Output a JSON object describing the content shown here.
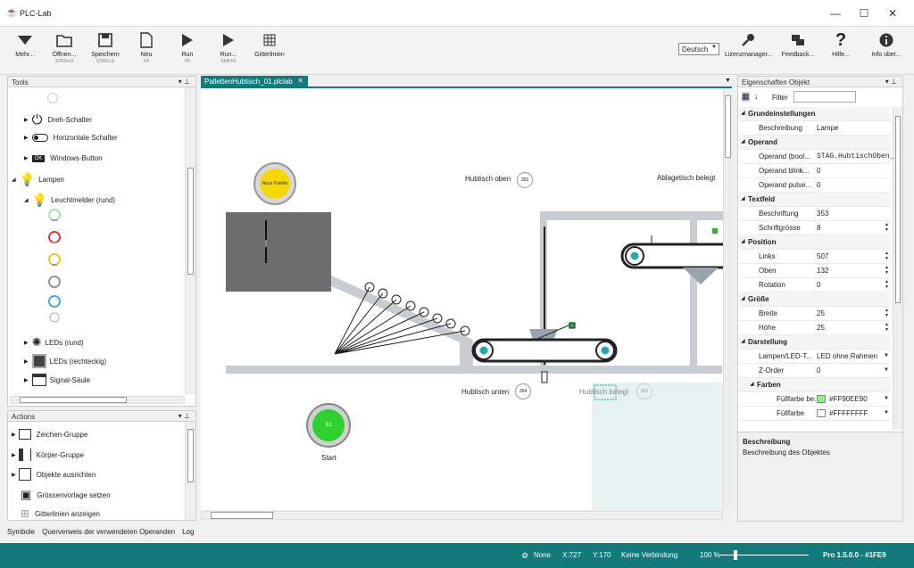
{
  "app": {
    "title": "PLC-Lab"
  },
  "window": {
    "min": "—",
    "max": "☐",
    "close": "✕"
  },
  "toolbar": {
    "more": "Mehr...",
    "open": "Öffnen...",
    "open_sc": "STRG+O",
    "save": "Speichern",
    "save_sc": "STRG+S",
    "new": "Neu",
    "new_sc": "F4",
    "run": "Run",
    "run_sc": "F5",
    "run2": "Run...",
    "run2_sc": "Shift F5",
    "grid": "Gitterlinien",
    "language": "Deutsch",
    "license": "Lizenzmanager...",
    "feedback": "Feedback...",
    "help": "Hilfe...",
    "about": "Info über..."
  },
  "tools": {
    "header": "Tools",
    "items": [
      "Dreh-Schalter",
      "Horizontale Schalter",
      "Windows-Button",
      "Lampen",
      "Leuchtmelder (rund)",
      "LEDs (rund)",
      "LEDs (rechteckig)",
      "Signal-Säule"
    ],
    "ok_badge": "OK"
  },
  "actions": {
    "header": "Actions",
    "items": [
      "Zeichen-Gruppe",
      "Körper-Gruppe",
      "Objekte ausrichten",
      "Grössenvorlage setzen",
      "Gitterlinien anzeigen"
    ]
  },
  "tabs": {
    "doc": "PallettenHubtisch_01.plclab",
    "close": "✕"
  },
  "canvas": {
    "lamp_label": "Neue Palette",
    "hubtisch_oben": "Hubtisch oben",
    "oben_val": "353",
    "ablage": "Ablagetisch belegt",
    "hubtisch_unten": "Hubtisch unten",
    "unten_val": "354",
    "hubtisch_belegt": "Hubtisch belegt",
    "belegt_val": "352",
    "start_btn": "S1",
    "start_label": "Start"
  },
  "props": {
    "header": "Eigenschaften Objekt",
    "filter": "Filter",
    "rows": [
      {
        "k": "Grundeinstellungen",
        "v": "",
        "sec": true
      },
      {
        "k": "Beschreibung",
        "v": "Lampe"
      },
      {
        "k": "Operand",
        "v": "",
        "sec": true
      },
      {
        "k": "Operand (bool...",
        "v": "STAG.HubtischOben_"
      },
      {
        "k": "Operand blink...",
        "v": "0"
      },
      {
        "k": "Operand pulse...",
        "v": "0"
      },
      {
        "k": "Textfeld",
        "v": "",
        "sec": true
      },
      {
        "k": "Beschriftung",
        "v": "353"
      },
      {
        "k": "Schriftgrösse",
        "v": "8"
      },
      {
        "k": "Position",
        "v": "",
        "sec": true
      },
      {
        "k": "Links",
        "v": "507"
      },
      {
        "k": "Oben",
        "v": "132"
      },
      {
        "k": "Rotation",
        "v": "0"
      },
      {
        "k": "Größe",
        "v": "",
        "sec": true
      },
      {
        "k": "Breite",
        "v": "25"
      },
      {
        "k": "Höhe",
        "v": "25"
      },
      {
        "k": "Darstellung",
        "v": "",
        "sec": true
      },
      {
        "k": "Lampen/LED-T...",
        "v": "LED ohne Rahmen"
      },
      {
        "k": "Z-Order",
        "v": "0"
      },
      {
        "k": "Farben",
        "v": "",
        "sec": true
      },
      {
        "k": "Füllfarbe be...",
        "v": "#FF90EE90"
      },
      {
        "k": "Füllfarbe",
        "v": "#FFFFFFFF"
      }
    ],
    "desc_title": "Beschreibung",
    "desc_text": "Beschreibung des Objektes"
  },
  "bottom_tabs": [
    "Symbole",
    "Querverweis der verwendeten Operanden",
    "Log"
  ],
  "status": {
    "mode": "None",
    "x": "X:727",
    "y": "Y:170",
    "conn": "Keine Verbindung",
    "zoom": "100 %",
    "version": "Pro 1.5.0.0 - #1FE9"
  },
  "colors": {
    "accent": "#127a7a",
    "lamp_yellow": "#f5d800",
    "start_green": "#2fd12f",
    "fill_green": "#90ee90"
  }
}
